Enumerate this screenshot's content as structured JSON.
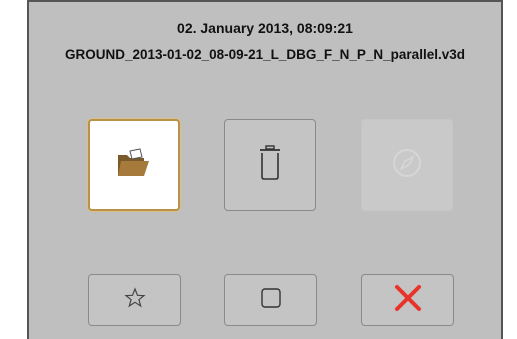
{
  "header": {
    "date": "02. January 2013, 08:09:21",
    "filename": "GROUND_2013-01-02_08-09-21_L_DBG_F_N_P_N_parallel.v3d"
  },
  "actions": {
    "open": {
      "icon": "folder-open-icon",
      "state": "selected"
    },
    "delete": {
      "icon": "trash-icon",
      "state": "enabled"
    },
    "navigate": {
      "icon": "compass-icon",
      "state": "disabled"
    }
  },
  "bottom": {
    "favorite": {
      "icon": "star-icon"
    },
    "select": {
      "icon": "checkbox-icon"
    },
    "close": {
      "icon": "close-icon"
    }
  },
  "colors": {
    "panel": "#bfbfbf",
    "selected_border": "#b9924a",
    "folder": "#a67a3a",
    "close": "#e8332a"
  }
}
